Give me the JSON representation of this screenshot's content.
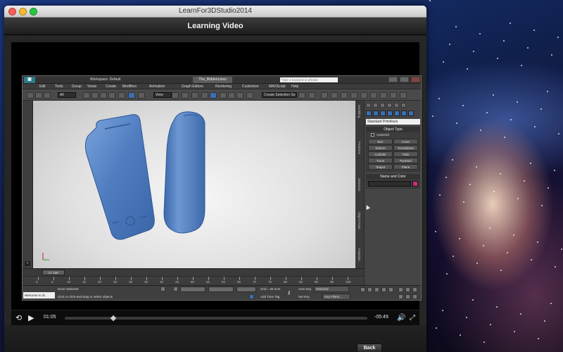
{
  "window": {
    "title": "LearnFor3DStudio2014",
    "header": "Learning Video"
  },
  "app": {
    "workspace": "Workspace: Default",
    "filename": "The_RiddenLines",
    "search_placeholder": "Type a keyword or phrase",
    "menus": [
      "Edit",
      "Tools",
      "Group",
      "Views",
      "Create",
      "Modifiers",
      "Animation",
      "Graph Editors",
      "Rendering",
      "Customize",
      "MAXScript",
      "Help"
    ],
    "toolbar": {
      "filter": "All",
      "ref_coord": "View",
      "selection_set": "Create Selection Se"
    },
    "viewport_tabs": [
      "Modeling",
      "Freeform",
      "Selection",
      "Object Paint",
      "Populate"
    ],
    "command_panel": {
      "category": "Standard Primitives",
      "object_type_title": "Object Type",
      "autogrid": "AutoGrid",
      "primitives": [
        "Box",
        "Cone",
        "Sphere",
        "GeoSphere",
        "Cylinder",
        "Tube",
        "Torus",
        "Pyramid",
        "Teapot",
        "Plane"
      ],
      "name_color_title": "Name and Color",
      "swatch_color": "#c8307a"
    },
    "time_slider": "0 / 100",
    "timeline_ticks": [
      "0",
      "5",
      "10",
      "15",
      "20",
      "25",
      "30",
      "35",
      "40",
      "45",
      "50",
      "55",
      "60",
      "65",
      "70",
      "75",
      "80",
      "85",
      "90",
      "95",
      "100"
    ],
    "status": {
      "welcome": "Welcome to 3L",
      "selection": "None Selected",
      "prompt": "Click or click-and-drag to select objects",
      "grid": "Grid = 25.4cm",
      "add_time_tag": "Add Time Tag",
      "auto_key": "Auto Key",
      "auto_key_value": "Selected",
      "set_key": "Set Key",
      "key_filters": "Key Filters..."
    }
  },
  "player": {
    "elapsed": "01:05",
    "remaining": "-05:49",
    "progress": 0.16
  },
  "footer": {
    "back_label": "Back"
  }
}
